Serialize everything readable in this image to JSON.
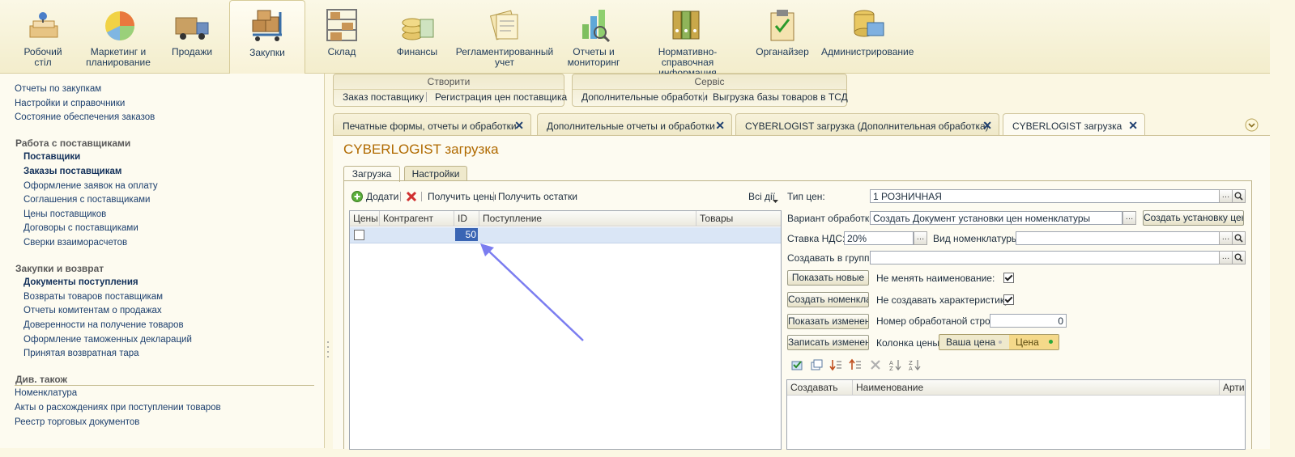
{
  "sections": [
    {
      "label": "Робочий\nстіл",
      "icon": "desktop-icon",
      "active": false
    },
    {
      "label": "Маркетинг и\nпланирование",
      "icon": "pie-chart-icon",
      "active": false
    },
    {
      "label": "Продажи",
      "icon": "truck-icon",
      "active": false
    },
    {
      "label": "Закупки",
      "icon": "boxes-cart-icon",
      "active": true
    },
    {
      "label": "Склад",
      "icon": "warehouse-shelf-icon",
      "active": false
    },
    {
      "label": "Финансы",
      "icon": "coins-icon",
      "active": false
    },
    {
      "label": "Регламентированный\nучет",
      "icon": "documents-icon",
      "active": false
    },
    {
      "label": "Отчеты и\nмониторинг",
      "icon": "bar-chart-magnifier-icon",
      "active": false
    },
    {
      "label": "Нормативно-справочная\nинформация",
      "icon": "binders-icon",
      "active": false
    },
    {
      "label": "Органайзер",
      "icon": "clipboard-icon",
      "active": false
    },
    {
      "label": "Администрирование",
      "icon": "database-monitor-icon",
      "active": false
    }
  ],
  "left_panel": {
    "top_links": [
      "Отчеты по закупкам",
      "Настройки и справочники",
      "Состояние обеспечения заказов"
    ],
    "group1": {
      "title": "Работа с поставщиками",
      "items": [
        "Поставщики",
        "Заказы поставщикам",
        "Оформление заявок на оплату",
        "Соглашения с поставщиками",
        "Цены поставщиков",
        "Договоры с поставщиками",
        "Сверки взаиморасчетов"
      ]
    },
    "group2": {
      "title": "Закупки и возврат",
      "items": [
        "Документы поступления",
        "Возвраты товаров поставщикам",
        "Отчеты комитентам о продажах",
        "Доверенности на получение товаров",
        "Оформление таможенных деклараций",
        "Принятая возвратная тара"
      ]
    },
    "group3": {
      "title": "Див. також",
      "items": [
        "Номенклатура",
        "Акты о расхождениях при поступлении товаров",
        "Реестр торговых документов"
      ]
    }
  },
  "cmd_groups": {
    "create": {
      "title": "Створити",
      "items": [
        "Заказ поставщику",
        "Регистрация цен поставщика"
      ]
    },
    "service": {
      "title": "Сервіс",
      "items": [
        "Дополнительные обработки",
        "Выгрузка базы товаров в ТСД"
      ]
    }
  },
  "window_tabs": [
    {
      "title": "Печатные формы, отчеты и обработки",
      "close": "✕"
    },
    {
      "title": "Дополнительные отчеты и обработки",
      "close": "✕"
    },
    {
      "title": "CYBERLOGIST загрузка (Дополнительная обработка)",
      "close": "✕"
    },
    {
      "title": "CYBERLOGIST загрузка",
      "close": "✕"
    }
  ],
  "form": {
    "title": "CYBERLOGIST загрузка",
    "inner_tabs": [
      "Загрузка",
      "Настройки"
    ],
    "toolbar": {
      "add": "Додати",
      "get_prices": "Получить цены",
      "get_stock": "Получить остатки",
      "all_actions": "Всі дії"
    },
    "grid": {
      "columns": [
        "Цены",
        "Контрагент",
        "ID",
        "Поступление",
        "Товары"
      ],
      "rows": [
        {
          "prices": false,
          "contractor": "",
          "id": "50",
          "receipt": "",
          "goods": ""
        }
      ]
    },
    "fields": {
      "price_type_label": "Тип цен:",
      "price_type_value": "1 РОЗНИЧНАЯ",
      "variant_label": "Вариант обработки:",
      "variant_value": "Создать Документ установки цен номенклатуры",
      "create_setting_button": "Создать установку цен",
      "vat_label": "Ставка НДС:",
      "vat_value": "20%",
      "nom_kind_label": "Вид номенклатуры:",
      "nom_kind_value": "",
      "group_label": "Создавать в группе:",
      "group_value": "",
      "no_rename_label": "Не менять наименование:",
      "no_rename_checked": true,
      "no_char_label": "Не создавать характеристику:",
      "no_char_checked": true,
      "row_num_label": "Номер обработаной строки:",
      "row_num_value": "0",
      "price_col_label": "Колонка цены:",
      "price_col_option1": "Ваша цена",
      "price_col_option2": "Цена"
    },
    "buttons": [
      "Показать новые",
      "Создать номенкла...",
      "Показать изменен...",
      "Записать изменен..."
    ],
    "right_grid": {
      "columns": [
        "Создавать",
        "Наименование",
        "Артик"
      ]
    }
  },
  "colors": {
    "accent": "#b06a00",
    "link": "#1c3f6e",
    "selection": "#dae6f6",
    "arrow": "#7b7df0"
  }
}
